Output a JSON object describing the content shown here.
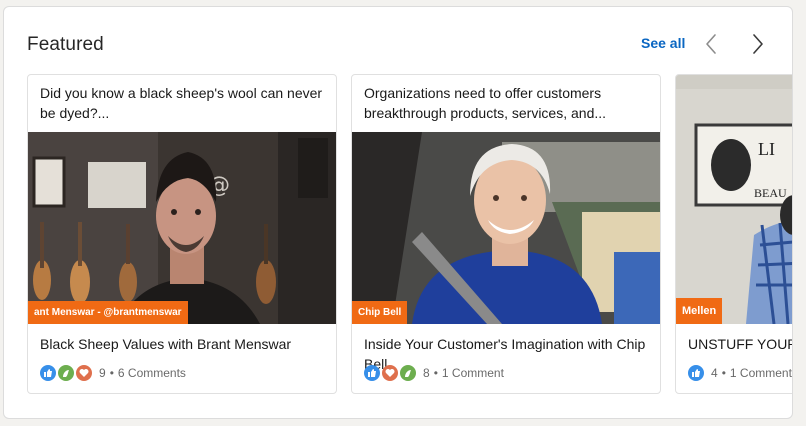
{
  "section": {
    "title": "Featured",
    "see_all_label": "See all"
  },
  "icons": {
    "prev": "chevron-left-icon",
    "next": "chevron-right-icon",
    "like": "like-reaction-icon",
    "support": "support-reaction-icon",
    "love": "love-reaction-icon"
  },
  "colors": {
    "accent": "#0a66c2",
    "name_tag": "#f06a14",
    "like": "#378fe9",
    "support": "#6dae4f",
    "love": "#df704d"
  },
  "cards": [
    {
      "text": "Did you know a black sheep's wool can never be dyed?...",
      "name_tag": "ant Menswar - @brantmenswar",
      "title": "Black Sheep Values with Brant Menswar",
      "reactions": [
        "like",
        "support",
        "love"
      ],
      "reaction_count": "9",
      "dot": "•",
      "comments": "6 Comments"
    },
    {
      "text": "Organizations need to offer customers breakthrough products, services, and...",
      "name_tag": "Chip Bell",
      "title": "Inside Your Customer's Imagination with Chip Bell",
      "reactions": [
        "like",
        "love",
        "support"
      ],
      "reaction_count": "8",
      "dot": "•",
      "comments": "1 Comment"
    },
    {
      "text": "",
      "name_tag": "Mellen",
      "title": "UNSTUFF YOUR LIFE with Andrew Mellen",
      "reactions": [
        "like"
      ],
      "reaction_count": "4",
      "dot": "•",
      "comments": "1 Comment"
    }
  ]
}
